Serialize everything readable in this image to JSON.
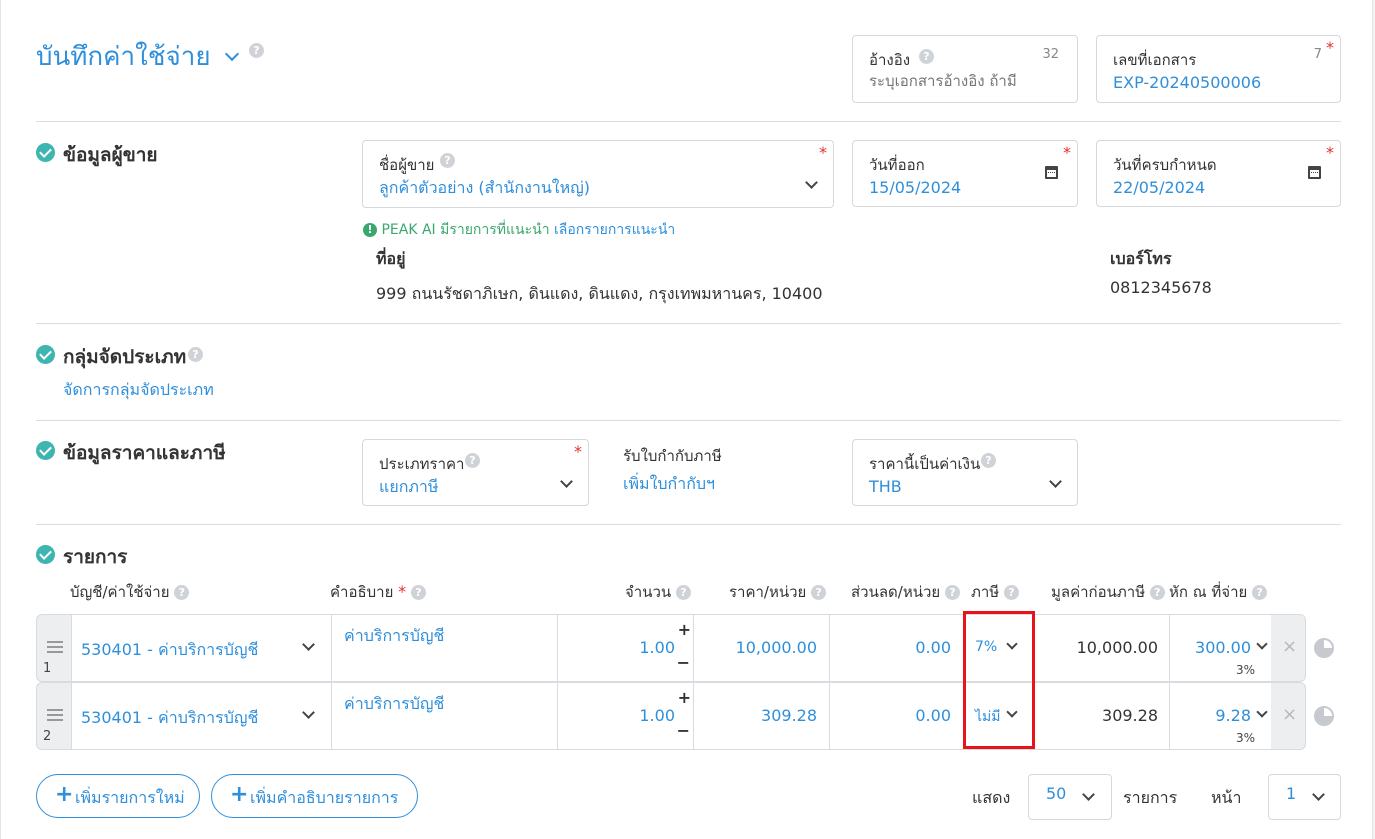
{
  "header": {
    "title": "บันทึกค่าใช้จ่าย",
    "reference": {
      "label": "อ้างอิง",
      "counter": "32",
      "placeholder": "ระบุเอกสารอ้างอิง ถ้ามี"
    },
    "document_no": {
      "label": "เลขที่เอกสาร",
      "counter": "7",
      "value": "EXP-20240500006"
    }
  },
  "seller": {
    "section_title": "ข้อมูลผู้ขาย",
    "vendor_label": "ชื่อผู้ขาย",
    "vendor_value": "ลูกค้าตัวอย่าง (สำนักงานใหญ่)",
    "issue_date_label": "วันที่ออก",
    "issue_date": "15/05/2024",
    "due_date_label": "วันที่ครบกำหนด",
    "due_date": "22/05/2024",
    "ai_hint_prefix": "PEAK AI มีรายการที่แนะนำ",
    "ai_hint_link": "เลือกรายการแนะนำ",
    "address_label": "ที่อยู่",
    "address": "999 ถนนรัชดาภิเษก, ดินแดง, ดินแดง, กรุงเทพมหานคร, 10400",
    "phone_label": "เบอร์โทร",
    "phone": "0812345678"
  },
  "category": {
    "section_title": "กลุ่มจัดประเภท",
    "manage_link": "จัดการกลุ่มจัดประเภท"
  },
  "pricing": {
    "section_title": "ข้อมูลราคาและภาษี",
    "price_type_label": "ประเภทราคา",
    "price_type_value": "แยกภาษี",
    "tax_invoice_label": "รับใบกำกับภาษี",
    "tax_invoice_link": "เพิ่มใบกำกับฯ",
    "currency_label": "ราคานี้เป็นค่าเงิน",
    "currency_value": "THB"
  },
  "items": {
    "section_title": "รายการ",
    "columns": {
      "account": "บัญชี/ค่าใช้จ่าย",
      "description": "คำอธิบาย",
      "qty": "จำนวน",
      "unit_price": "ราคา/หน่วย",
      "discount": "ส่วนลด/หน่วย",
      "tax": "ภาษี",
      "pretax": "มูลค่าก่อนภาษี",
      "withholding": "หัก ณ ที่จ่าย"
    },
    "rows": [
      {
        "index": "1",
        "account": "530401 - ค่าบริการบัญชี",
        "description": "ค่าบริการบัญชี",
        "qty": "1.00",
        "unit_price": "10,000.00",
        "discount": "0.00",
        "tax": "7%",
        "pretax": "10,000.00",
        "withholding": "300.00",
        "withholding_rate": "3%"
      },
      {
        "index": "2",
        "account": "530401 - ค่าบริการบัญชี",
        "description": "ค่าบริการบัญชี",
        "qty": "1.00",
        "unit_price": "309.28",
        "discount": "0.00",
        "tax": "ไม่มี",
        "pretax": "309.28",
        "withholding": "9.28",
        "withholding_rate": "3%"
      }
    ],
    "add_item_button": "เพิ่มรายการใหม่",
    "add_desc_button": "เพิ่มคำอธิบายรายการ",
    "show_label": "แสดง",
    "page_size": "50",
    "items_label": "รายการ",
    "page_label": "หน้า",
    "page": "1"
  },
  "colors": {
    "accent": "#2f8fdb",
    "check": "#3db5b0",
    "required": "#e03131",
    "ai_hint": "#3aa76d",
    "highlight": "#e8141b"
  }
}
